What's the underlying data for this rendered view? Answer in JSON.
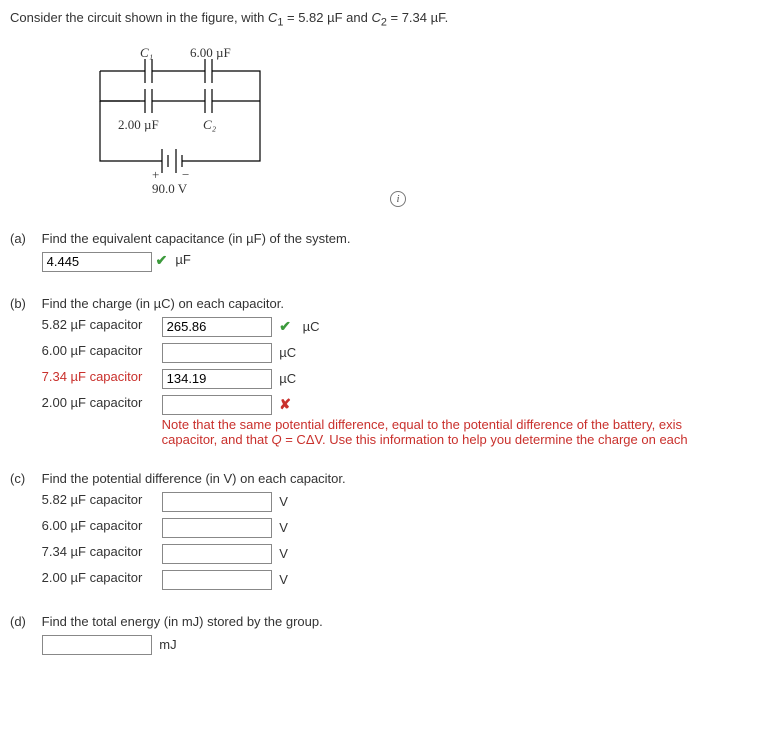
{
  "problem_intro_a": "Consider the circuit shown in the figure, with ",
  "problem_intro_b": " = 5.82 µF and ",
  "problem_intro_c": " = 7.34 µF.",
  "c1_sym_a": "C",
  "c1_sym_b": "1",
  "c2_sym_a": "C",
  "c2_sym_b": "2",
  "circuit": {
    "c1": "C₁",
    "top": "6.00 µF",
    "left": "2.00 µF",
    "c2": "C₂",
    "plus": "+",
    "minus": "−",
    "volt": "90.0 V"
  },
  "parts": {
    "a": {
      "label": "(a)",
      "text": "Find the equivalent capacitance (in µF) of the system.",
      "value": "4.445",
      "unit": "µF"
    },
    "b": {
      "label": "(b)",
      "text": "Find the charge (in µC) on each capacitor.",
      "rows": [
        {
          "label": "5.82 µF capacitor",
          "value": "265.86",
          "unit": "µC",
          "mark": "check",
          "wrong": false
        },
        {
          "label": "6.00 µF capacitor",
          "value": "",
          "unit": "µC",
          "mark": "",
          "wrong": false
        },
        {
          "label": "7.34 µF capacitor",
          "value": "134.19",
          "unit": "µC",
          "mark": "",
          "wrong": true
        },
        {
          "label": "2.00 µF capacitor",
          "value": "",
          "unit": "",
          "mark": "cross",
          "wrong": false
        }
      ],
      "feedback_a": "Note that the same potential difference, equal to the potential difference of the battery, exis",
      "feedback_b": "capacitor, and that ",
      "feedback_q": "Q",
      "feedback_c": " = CΔV. Use this information to help you determine the charge on each"
    },
    "c": {
      "label": "(c)",
      "text": "Find the potential difference (in V) on each capacitor.",
      "rows": [
        {
          "label": "5.82 µF capacitor",
          "unit": "V"
        },
        {
          "label": "6.00 µF capacitor",
          "unit": "V"
        },
        {
          "label": "7.34 µF capacitor",
          "unit": "V"
        },
        {
          "label": "2.00 µF capacitor",
          "unit": "V"
        }
      ]
    },
    "d": {
      "label": "(d)",
      "text": "Find the total energy (in mJ) stored by the group.",
      "unit": "mJ"
    }
  }
}
